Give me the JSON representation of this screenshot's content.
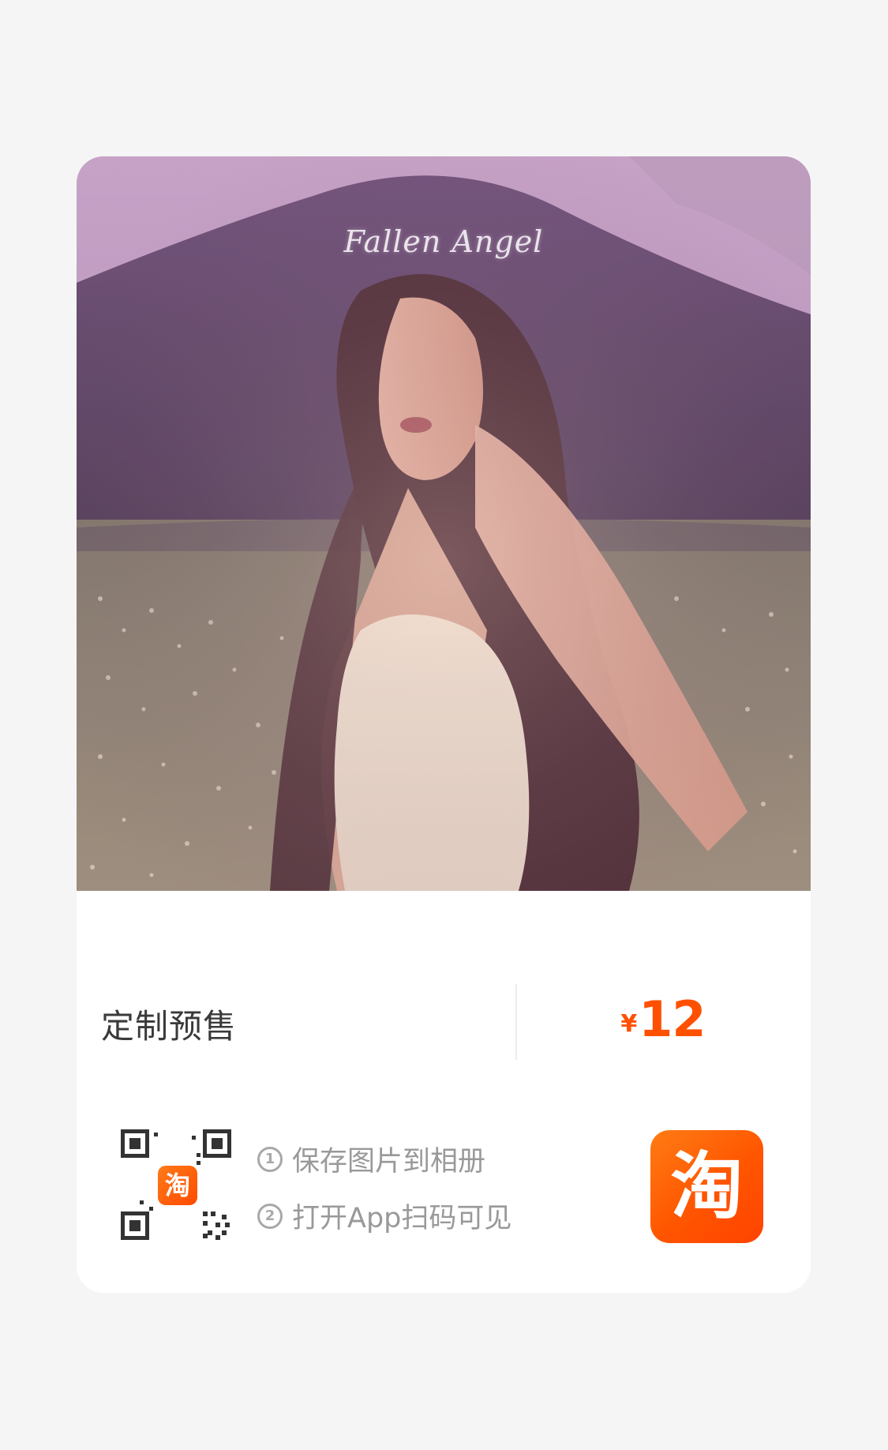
{
  "product": {
    "image_title": "Fallen Angel",
    "label": "定制预售",
    "price": {
      "currency": "¥",
      "amount": "12"
    }
  },
  "share": {
    "qr_logo_text": "淘",
    "steps": [
      {
        "num": "1",
        "text": "保存图片到相册"
      },
      {
        "num": "2",
        "text": "打开App扫码可见"
      }
    ],
    "app_logo_text": "淘"
  },
  "colors": {
    "accent": "#ff5000",
    "background": "#f5f5f5",
    "card": "#ffffff"
  }
}
